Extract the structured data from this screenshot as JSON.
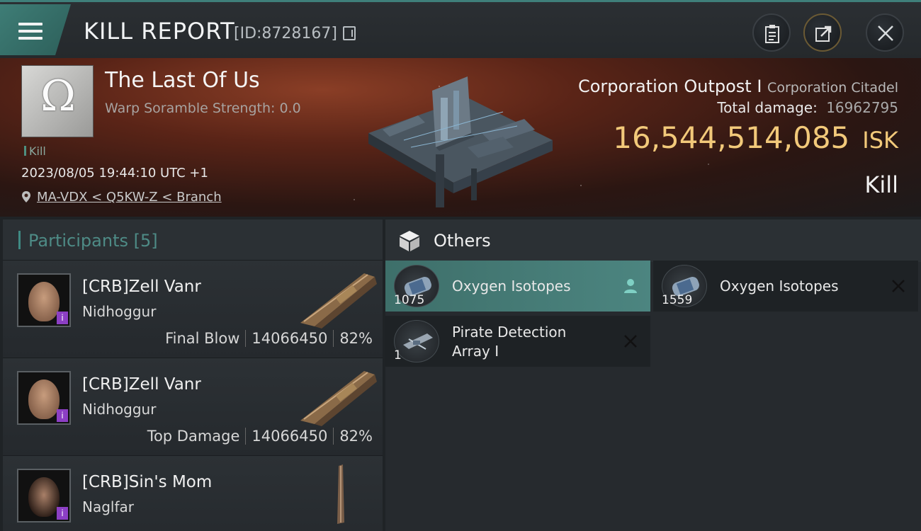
{
  "header": {
    "title": "KILL REPORT",
    "report_id": "[ID:8728167]"
  },
  "victim": {
    "name": "The Last Of Us",
    "warp_scramble": "Warp Soramble Strength: 0.0",
    "tag": "Kill",
    "datetime": "2023/08/05 19:44:10 UTC +1",
    "location": "MA-VDX < Q5KW-Z < Branch"
  },
  "target": {
    "name": "Corporation Outpost I",
    "type": "Corporation Citadel",
    "damage_label": "Total damage:",
    "damage_value": "16962795",
    "isk_value": "16,544,514,085",
    "isk_unit": "ISK",
    "result": "Kill"
  },
  "participants": {
    "title": "Participants [5]",
    "items": [
      {
        "name": "[CRB]Zell Vanr",
        "ship": "Nidhoggur",
        "role": "Final Blow",
        "damage": "14066450",
        "percent": "82%",
        "face_color": "#b68a6c"
      },
      {
        "name": "[CRB]Zell Vanr",
        "ship": "Nidhoggur",
        "role": "Top Damage",
        "damage": "14066450",
        "percent": "82%",
        "face_color": "#b68a6c"
      },
      {
        "name": "[CRB]Sin's Mom",
        "ship": "Naglfar",
        "role": "",
        "damage": "",
        "percent": "",
        "face_color": "#8f6a58"
      }
    ]
  },
  "others": {
    "title": "Others",
    "items": [
      {
        "qty": "1075",
        "name": "Oxygen Isotopes",
        "mark": "person-icon"
      },
      {
        "qty": "1559",
        "name": "Oxygen Isotopes",
        "mark": "close-icon"
      },
      {
        "qty": "1",
        "name": "Pirate Detection Array I",
        "mark": "close-icon"
      }
    ]
  },
  "colors": {
    "accent": "#3f8a83",
    "isk": "#f2c97a",
    "selected_bg": "#4c8580"
  }
}
